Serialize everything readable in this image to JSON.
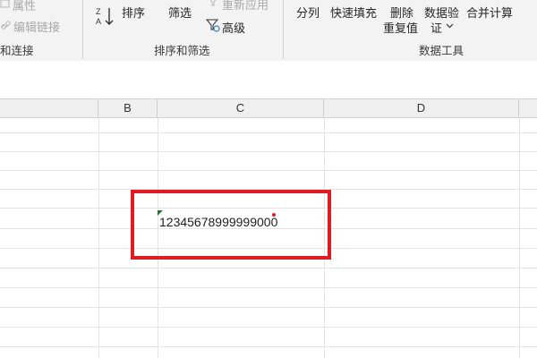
{
  "ribbon": {
    "connections": {
      "properties_label": "属性",
      "edit_links_label": "编辑链接",
      "group_label": "和连接"
    },
    "sort_filter": {
      "sort_label": "排序",
      "filter_label": "筛选",
      "reapply_label": "重新应用",
      "advanced_label": "高级",
      "group_label": "排序和筛选"
    },
    "data_tools": {
      "split_label": "分列",
      "flash_fill_label": "快速填充",
      "remove_duplicates_line1": "删除",
      "remove_duplicates_line2": "重复值",
      "validation_line1": "数据验",
      "validation_line2": "证",
      "consolidate_label": "合并计算",
      "group_label": "数据工具"
    }
  },
  "sheet": {
    "columns": [
      "B",
      "C",
      "D"
    ],
    "cell_C_value": "12345678999999000"
  },
  "colors": {
    "highlight": "#e01b24",
    "error_indicator": "#1f7a2f",
    "ribbon_bg": "#f3f3f3"
  }
}
